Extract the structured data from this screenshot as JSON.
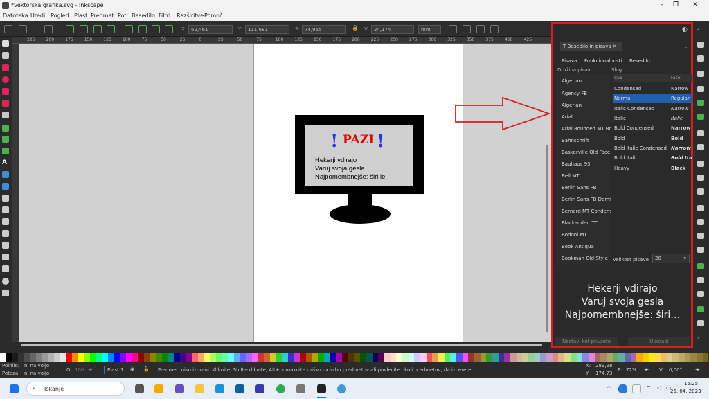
{
  "window": {
    "title": "*Vektorska grafika.svg - Inkscape",
    "min": "–",
    "max": "❐",
    "close": "✕"
  },
  "menu": [
    "Datoteka",
    "Uredi",
    "Pogled",
    "Plast",
    "Predmet",
    "Pot",
    "Besedilo",
    "Filtri",
    "Razširitve",
    "Pomoč"
  ],
  "toolbar": {
    "x_label": "X:",
    "x": "62,461",
    "y_label": "Y:",
    "y": "111,681",
    "w_label": "Š:",
    "w": "74,965",
    "h_label": "V:",
    "h": "24,174",
    "unit": "mm"
  },
  "ruler_top": [
    "225",
    "200",
    "175",
    "150",
    "125",
    "100",
    "75",
    "50",
    "25",
    "0",
    "25",
    "50",
    "75",
    "100",
    "125",
    "150",
    "175",
    "200",
    "225",
    "250",
    "275",
    "300",
    "325",
    "350",
    "375",
    "400",
    "425"
  ],
  "drawing": {
    "warning": "PAZI",
    "line1": "Hekerji vdirajo",
    "line2": "Varuj svoja gesla",
    "line3": "Najpomembnejše: širi le"
  },
  "dock": {
    "panel_title": "Besedilo in pisava",
    "tabs": [
      "Pisava",
      "Funkcionalnosti",
      "Besedilo"
    ],
    "family_header": "Družina pisav",
    "style_header": "Slog",
    "col_css": "CSS",
    "col_face": "Face",
    "families": [
      "Algerian",
      "Agency FB",
      "Algerian",
      "Arial",
      "Arial Rounded MT Bold",
      "Bahnschrift",
      "Baskerville Old Face",
      "Bauhaus 93",
      "Bell MT",
      "Berlin Sans FB",
      "Berlin Sans FB Demi",
      "Bernard MT Condensed",
      "Blackadder ITC",
      "Bodoni MT",
      "Book Antiqua",
      "Bookman Old Style"
    ],
    "styles": [
      {
        "css": "Condensed",
        "face": "Narrow"
      },
      {
        "css": "Normal",
        "face": "Regular"
      },
      {
        "css": "Italic Condensed",
        "face": "Narrow"
      },
      {
        "css": "Italic",
        "face": "Italic"
      },
      {
        "css": "Bold Condensed",
        "face": "Narrow"
      },
      {
        "css": "Bold",
        "face": "Bold"
      },
      {
        "css": "Bold Italic Condensed",
        "face": "Narrow"
      },
      {
        "css": "Bold Italic",
        "face": "Bold Ita"
      },
      {
        "css": "Heavy",
        "face": "Black"
      }
    ],
    "size_label": "Velikost pisave",
    "size_value": "20",
    "preview": [
      "Hekerji vdirajo",
      "Varuj svoja gesla",
      "Najpomembnejše: širi…"
    ],
    "set_default": "Nastavi kot privzeto",
    "apply": "Uporabi"
  },
  "status": {
    "fill_label": "Polnilo:",
    "fill_value": "ni na voljo",
    "stroke_label": "Poteza:",
    "stroke_value": "ni na voljo",
    "opacity_label": "O:",
    "opacity": "100",
    "layer": "Plast 1",
    "message": "Predmeti niso izbrani. Kliknite, Shift+kliknite, Alt+pomaknite miško na vrhu predmetov ali povlecite okoli predmetov, da izberete.",
    "cx_label": "X:",
    "cx": "289,98",
    "cy_label": "Y:",
    "cy": "174,73",
    "zoom_label": "P:",
    "zoom": "72%",
    "rot_label": "V:",
    "rotation": "0,00°"
  },
  "taskbar": {
    "search": "Iskanje",
    "time": "15:25",
    "date": "25. 04. 2023"
  },
  "colors": {
    "highlight": "#d81e1e",
    "selected": "#1f5fae",
    "accent": "#3b6fb6"
  }
}
